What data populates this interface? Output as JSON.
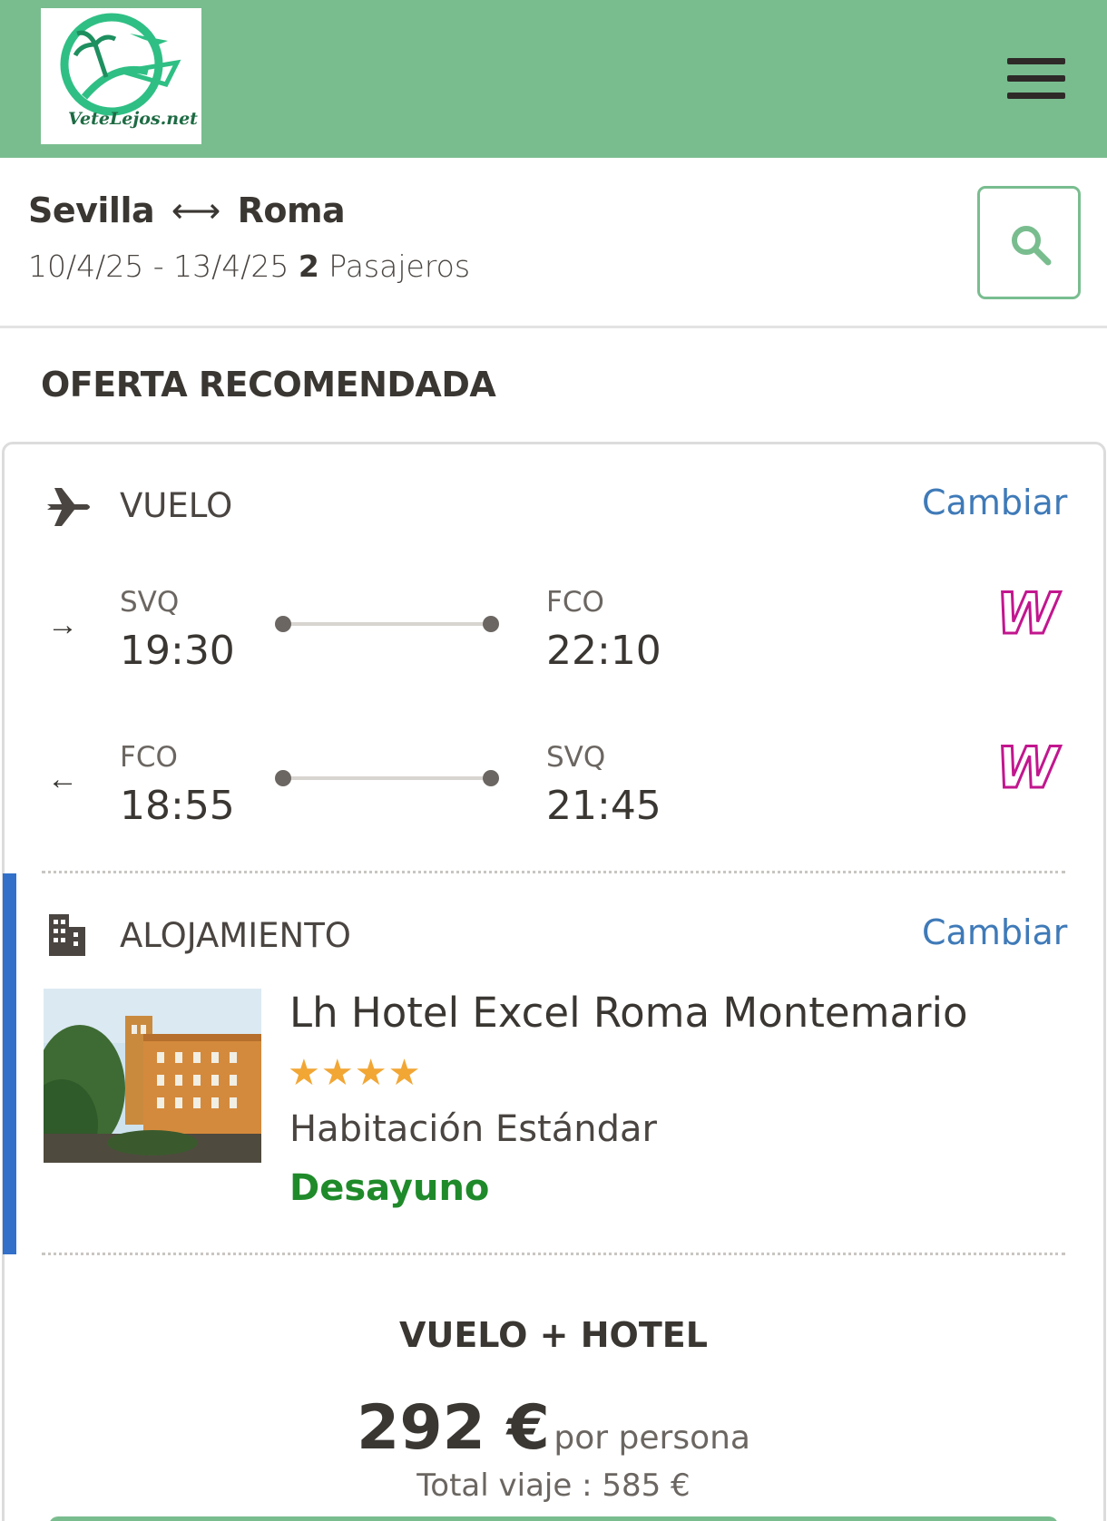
{
  "header": {
    "logo_text": "VeteLejos.net",
    "menu_icon": "hamburger-menu-icon"
  },
  "search": {
    "origin": "Sevilla",
    "destination": "Roma",
    "arrow": "⟷",
    "dates": "10/4/25 - 13/4/25",
    "passengers_count": "2",
    "passengers_label": "Pasajeros",
    "search_icon": "search-icon"
  },
  "section_title": "OFERTA RECOMENDADA",
  "flight": {
    "label": "VUELO",
    "change": "Cambiar",
    "outbound": {
      "from_code": "SVQ",
      "from_time": "19:30",
      "to_code": "FCO",
      "to_time": "22:10",
      "airline_logo": "W"
    },
    "inbound": {
      "from_code": "FCO",
      "from_time": "18:55",
      "to_code": "SVQ",
      "to_time": "21:45",
      "airline_logo": "W"
    }
  },
  "accommodation": {
    "label": "ALOJAMIENTO",
    "change": "Cambiar",
    "hotel_name": "Lh Hotel Excel Roma Montemario",
    "stars": 4,
    "stars_text": "★★★★",
    "room": "Habitación Estándar",
    "meal": "Desayuno"
  },
  "pricing": {
    "package_label": "VUELO + HOTEL",
    "price": "292 €",
    "per_person": "por persona",
    "total": "Total viaje : 585 €"
  },
  "colors": {
    "header_bg": "#79bd8f",
    "link": "#3f7ab8",
    "meal": "#1f8a2a",
    "star": "#f2a634",
    "accent_bar": "#3270c9"
  }
}
